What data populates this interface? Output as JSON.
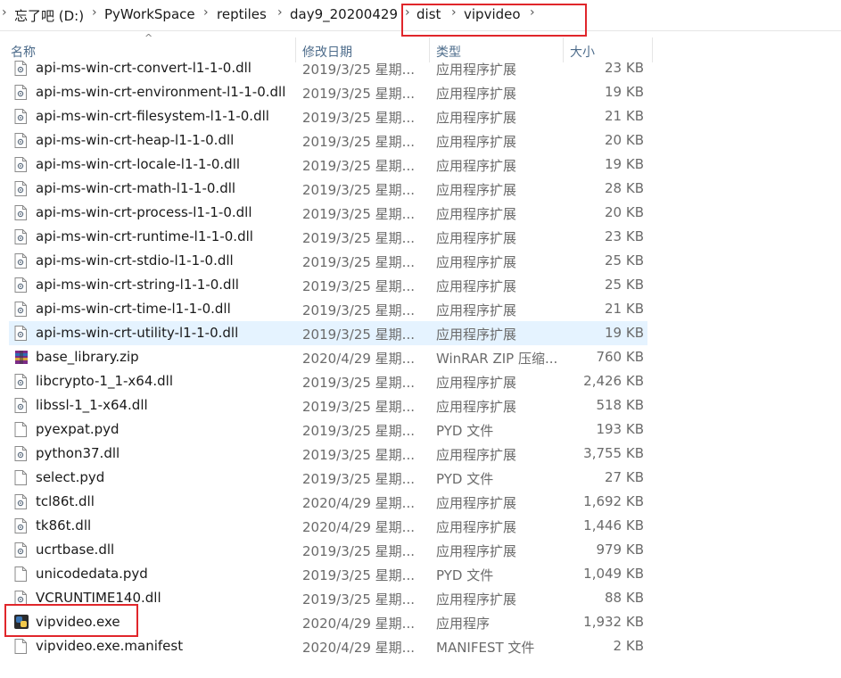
{
  "breadcrumb": [
    "忘了吧 (D:)",
    "PyWorkSpace",
    "reptiles",
    "day9_20200429",
    "dist",
    "vipvideo"
  ],
  "columns": {
    "name": "名称",
    "date": "修改日期",
    "type": "类型",
    "size": "大小"
  },
  "files": [
    {
      "name": "api-ms-win-crt-convert-l1-1-0.dll",
      "date": "2019/3/25 星期...",
      "type": "应用程序扩展",
      "size": "23 KB",
      "icon": "dll-file-icon"
    },
    {
      "name": "api-ms-win-crt-environment-l1-1-0.dll",
      "date": "2019/3/25 星期...",
      "type": "应用程序扩展",
      "size": "19 KB",
      "icon": "dll-file-icon"
    },
    {
      "name": "api-ms-win-crt-filesystem-l1-1-0.dll",
      "date": "2019/3/25 星期...",
      "type": "应用程序扩展",
      "size": "21 KB",
      "icon": "dll-file-icon"
    },
    {
      "name": "api-ms-win-crt-heap-l1-1-0.dll",
      "date": "2019/3/25 星期...",
      "type": "应用程序扩展",
      "size": "20 KB",
      "icon": "dll-file-icon"
    },
    {
      "name": "api-ms-win-crt-locale-l1-1-0.dll",
      "date": "2019/3/25 星期...",
      "type": "应用程序扩展",
      "size": "19 KB",
      "icon": "dll-file-icon"
    },
    {
      "name": "api-ms-win-crt-math-l1-1-0.dll",
      "date": "2019/3/25 星期...",
      "type": "应用程序扩展",
      "size": "28 KB",
      "icon": "dll-file-icon"
    },
    {
      "name": "api-ms-win-crt-process-l1-1-0.dll",
      "date": "2019/3/25 星期...",
      "type": "应用程序扩展",
      "size": "20 KB",
      "icon": "dll-file-icon"
    },
    {
      "name": "api-ms-win-crt-runtime-l1-1-0.dll",
      "date": "2019/3/25 星期...",
      "type": "应用程序扩展",
      "size": "23 KB",
      "icon": "dll-file-icon"
    },
    {
      "name": "api-ms-win-crt-stdio-l1-1-0.dll",
      "date": "2019/3/25 星期...",
      "type": "应用程序扩展",
      "size": "25 KB",
      "icon": "dll-file-icon"
    },
    {
      "name": "api-ms-win-crt-string-l1-1-0.dll",
      "date": "2019/3/25 星期...",
      "type": "应用程序扩展",
      "size": "25 KB",
      "icon": "dll-file-icon"
    },
    {
      "name": "api-ms-win-crt-time-l1-1-0.dll",
      "date": "2019/3/25 星期...",
      "type": "应用程序扩展",
      "size": "21 KB",
      "icon": "dll-file-icon"
    },
    {
      "name": "api-ms-win-crt-utility-l1-1-0.dll",
      "date": "2019/3/25 星期...",
      "type": "应用程序扩展",
      "size": "19 KB",
      "icon": "dll-file-icon",
      "selected": true
    },
    {
      "name": "base_library.zip",
      "date": "2020/4/29 星期...",
      "type": "WinRAR ZIP 压缩...",
      "size": "760 KB",
      "icon": "winrar-archive-icon"
    },
    {
      "name": "libcrypto-1_1-x64.dll",
      "date": "2019/3/25 星期...",
      "type": "应用程序扩展",
      "size": "2,426 KB",
      "icon": "dll-file-icon"
    },
    {
      "name": "libssl-1_1-x64.dll",
      "date": "2019/3/25 星期...",
      "type": "应用程序扩展",
      "size": "518 KB",
      "icon": "dll-file-icon"
    },
    {
      "name": "pyexpat.pyd",
      "date": "2019/3/25 星期...",
      "type": "PYD 文件",
      "size": "193 KB",
      "icon": "blank-file-icon"
    },
    {
      "name": "python37.dll",
      "date": "2019/3/25 星期...",
      "type": "应用程序扩展",
      "size": "3,755 KB",
      "icon": "dll-file-icon"
    },
    {
      "name": "select.pyd",
      "date": "2019/3/25 星期...",
      "type": "PYD 文件",
      "size": "27 KB",
      "icon": "blank-file-icon"
    },
    {
      "name": "tcl86t.dll",
      "date": "2020/4/29 星期...",
      "type": "应用程序扩展",
      "size": "1,692 KB",
      "icon": "dll-file-icon"
    },
    {
      "name": "tk86t.dll",
      "date": "2020/4/29 星期...",
      "type": "应用程序扩展",
      "size": "1,446 KB",
      "icon": "dll-file-icon"
    },
    {
      "name": "ucrtbase.dll",
      "date": "2019/3/25 星期...",
      "type": "应用程序扩展",
      "size": "979 KB",
      "icon": "dll-file-icon"
    },
    {
      "name": "unicodedata.pyd",
      "date": "2019/3/25 星期...",
      "type": "PYD 文件",
      "size": "1,049 KB",
      "icon": "blank-file-icon"
    },
    {
      "name": "VCRUNTIME140.dll",
      "date": "2019/3/25 星期...",
      "type": "应用程序扩展",
      "size": "88 KB",
      "icon": "dll-file-icon"
    },
    {
      "name": "vipvideo.exe",
      "date": "2020/4/29 星期...",
      "type": "应用程序",
      "size": "1,932 KB",
      "icon": "python-exe-icon"
    },
    {
      "name": "vipvideo.exe.manifest",
      "date": "2020/4/29 星期...",
      "type": "MANIFEST 文件",
      "size": "2 KB",
      "icon": "blank-file-icon"
    }
  ],
  "colors": {
    "selection": "#e5f3ff",
    "highlight_box": "#e0262b",
    "header_text": "#4d6c8b"
  }
}
